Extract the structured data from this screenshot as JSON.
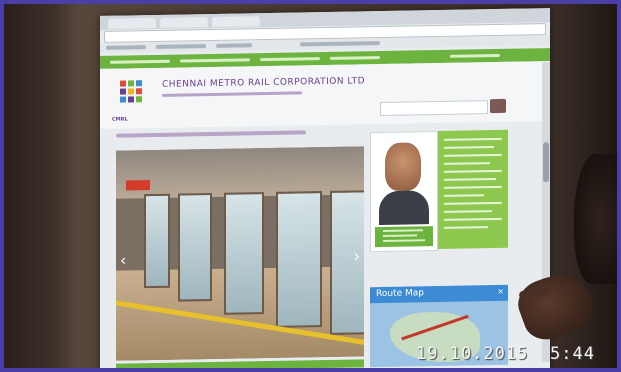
{
  "site": {
    "org_title": "CHENNAI METRO RAIL CORPORATION LTD",
    "logo_text": "CMRL"
  },
  "widgets": {
    "route_map_title": "Route Map",
    "route_map_close": "×"
  },
  "slider": {
    "prev_icon": "chevron-left-icon",
    "next_icon": "chevron-right-icon"
  },
  "camera": {
    "date": "19.10.2015",
    "time": "5:44"
  },
  "colors": {
    "nav_green": "#6db33f",
    "brand_purple": "#6a3f8f",
    "route_blue": "#3d8bd4",
    "frame_border": "#4a3fa6"
  }
}
